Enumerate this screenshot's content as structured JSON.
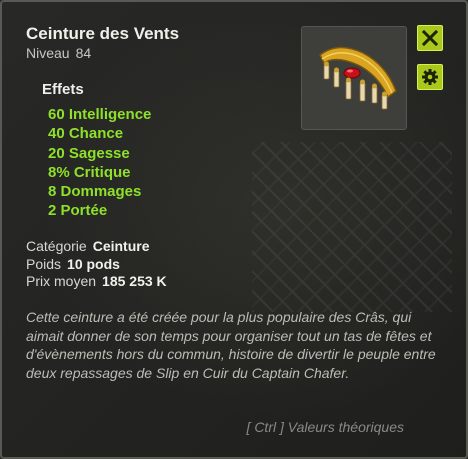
{
  "item": {
    "name": "Ceinture des Vents",
    "level_label": "Niveau",
    "level_value": "84",
    "image_name": "belt-item-image"
  },
  "buttons": {
    "close_icon": "close-x-icon",
    "settings_icon": "gear-icon"
  },
  "effects": {
    "heading": "Effets",
    "items": [
      "60 Intelligence",
      "40 Chance",
      "20 Sagesse",
      "8% Critique",
      "8 Dommages",
      "2 Portée"
    ]
  },
  "info": {
    "category_label": "Catégorie",
    "category_value": "Ceinture",
    "weight_label": "Poids",
    "weight_value": "10 pods",
    "price_label": "Prix moyen",
    "price_value": "185 253 K"
  },
  "description": "Cette ceinture a été créée pour la plus populaire des Crâs, qui aimait donner de son temps pour organiser tout un tas de fêtes et d'évènements hors du commun, histoire de divertir le peuple entre deux repassages de Slip en Cuir du Captain Chafer.",
  "footer_hint": "[ Ctrl ] Valeurs théoriques",
  "colors": {
    "effect_green": "#8ee02a",
    "button_lime": "#a8c81c",
    "panel_bg": "#2a2a28"
  }
}
